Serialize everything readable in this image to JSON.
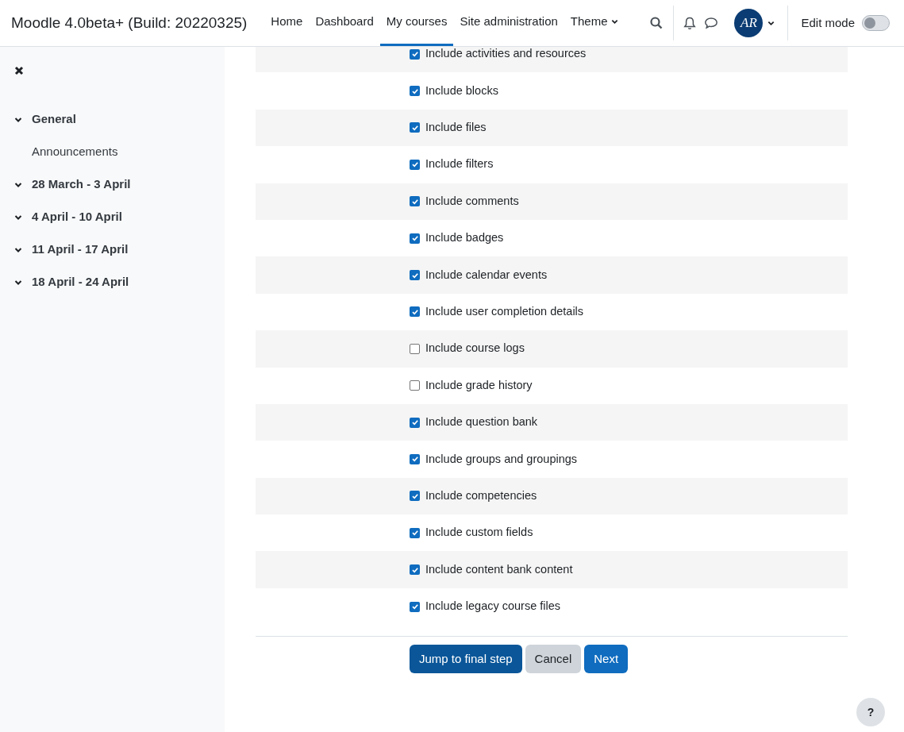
{
  "header": {
    "site_name": "Moodle 4.0beta+ (Build: 20220325)",
    "nav": [
      {
        "label": "Home",
        "selected": false,
        "dropdown": false
      },
      {
        "label": "Dashboard",
        "selected": false,
        "dropdown": false
      },
      {
        "label": "My courses",
        "selected": true,
        "dropdown": false
      },
      {
        "label": "Site administration",
        "selected": false,
        "dropdown": false
      },
      {
        "label": "Theme",
        "selected": false,
        "dropdown": true
      }
    ],
    "avatar_initials": "AR",
    "edit_mode": {
      "label": "Edit mode",
      "on": false
    }
  },
  "sidebar": {
    "sections": [
      {
        "label": "General",
        "expanded": true,
        "children": [
          {
            "label": "Announcements"
          }
        ]
      },
      {
        "label": "28 March - 3 April",
        "expanded": true
      },
      {
        "label": "4 April - 10 April",
        "expanded": true
      },
      {
        "label": "11 April - 17 April",
        "expanded": true
      },
      {
        "label": "18 April - 24 April",
        "expanded": true
      }
    ]
  },
  "settings": [
    {
      "label": "Include activities and resources",
      "checked": true
    },
    {
      "label": "Include blocks",
      "checked": true
    },
    {
      "label": "Include files",
      "checked": true
    },
    {
      "label": "Include filters",
      "checked": true
    },
    {
      "label": "Include comments",
      "checked": true
    },
    {
      "label": "Include badges",
      "checked": true
    },
    {
      "label": "Include calendar events",
      "checked": true
    },
    {
      "label": "Include user completion details",
      "checked": true
    },
    {
      "label": "Include course logs",
      "checked": false
    },
    {
      "label": "Include grade history",
      "checked": false
    },
    {
      "label": "Include question bank",
      "checked": true
    },
    {
      "label": "Include groups and groupings",
      "checked": true
    },
    {
      "label": "Include competencies",
      "checked": true
    },
    {
      "label": "Include custom fields",
      "checked": true
    },
    {
      "label": "Include content bank content",
      "checked": true
    },
    {
      "label": "Include legacy course files",
      "checked": true
    }
  ],
  "buttons": [
    {
      "label": "Jump to final step",
      "kind": "primary-dark"
    },
    {
      "label": "Cancel",
      "kind": "secondary"
    },
    {
      "label": "Next",
      "kind": "primary"
    }
  ],
  "help_button": "?"
}
